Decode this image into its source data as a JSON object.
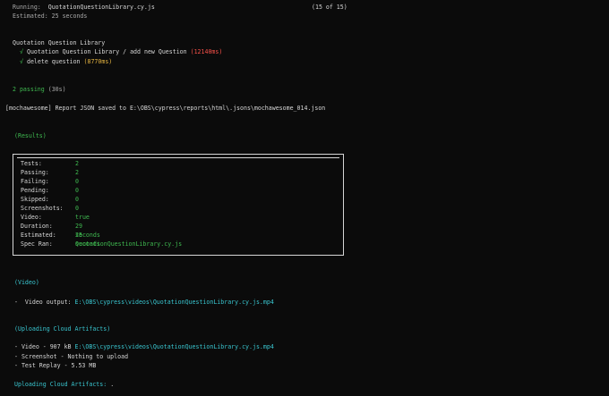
{
  "header": {
    "running_label": "Running:",
    "running_file": "QuotationQuestionLibrary.cy.js",
    "progress": "(15 of 15)",
    "estimated": "Estimated: 25 seconds"
  },
  "suite": {
    "title": "Quotation Question Library",
    "tests": [
      {
        "mark": "√",
        "name": "Quotation Question Library / add new Question",
        "duration": "(12140ms)",
        "duration_color": "#f85149"
      },
      {
        "mark": "√",
        "name": "delete question",
        "duration": "(8770ms)",
        "duration_color": "#e3b341"
      }
    ]
  },
  "summary": {
    "passing": "2 passing",
    "time": "(30s)"
  },
  "mochawesome": {
    "line": "[mochawesome] Report JSON saved to E:\\OBS\\cypress\\reports\\html\\.jsons\\mochawesome_014.json"
  },
  "results": {
    "heading": "(Results)",
    "rows": [
      {
        "key": "Tests:",
        "value": "2",
        "color": "#3fb950"
      },
      {
        "key": "Passing:",
        "value": "2",
        "color": "#3fb950"
      },
      {
        "key": "Failing:",
        "value": "0",
        "color": "#3fb950"
      },
      {
        "key": "Pending:",
        "value": "0",
        "color": "#3fb950"
      },
      {
        "key": "Skipped:",
        "value": "0",
        "color": "#3fb950"
      },
      {
        "key": "Screenshots:",
        "value": "0",
        "color": "#3fb950"
      },
      {
        "key": "Video:",
        "value": "true",
        "color": "#3fb950"
      },
      {
        "key": "Duration:",
        "value": "29 seconds",
        "color": "#3fb950"
      },
      {
        "key": "Estimated:",
        "value": "25 seconds",
        "color": "#3fb950"
      },
      {
        "key": "Spec Ran:",
        "value": "QuotationQuestionLibrary.cy.js",
        "color": "#3fb950"
      }
    ]
  },
  "video": {
    "heading": "(Video)",
    "output_prefix": "-  Video output: ",
    "output_path": "E:\\OBS\\cypress\\videos\\QuotationQuestionLibrary.cy.js.mp4"
  },
  "upload": {
    "heading": "(Uploading Cloud Artifacts)",
    "lines": [
      {
        "prefix": "- Video - 907 kB ",
        "path": "E:\\OBS\\cypress\\videos\\QuotationQuestionLibrary.cy.js.mp4"
      },
      {
        "prefix": "- Screenshot - Nothing to upload",
        "path": ""
      },
      {
        "prefix": "- Test Replay - 5.53 MB",
        "path": ""
      }
    ],
    "status_label": "Uploading Cloud Artifacts:",
    "status_dots": " ."
  }
}
